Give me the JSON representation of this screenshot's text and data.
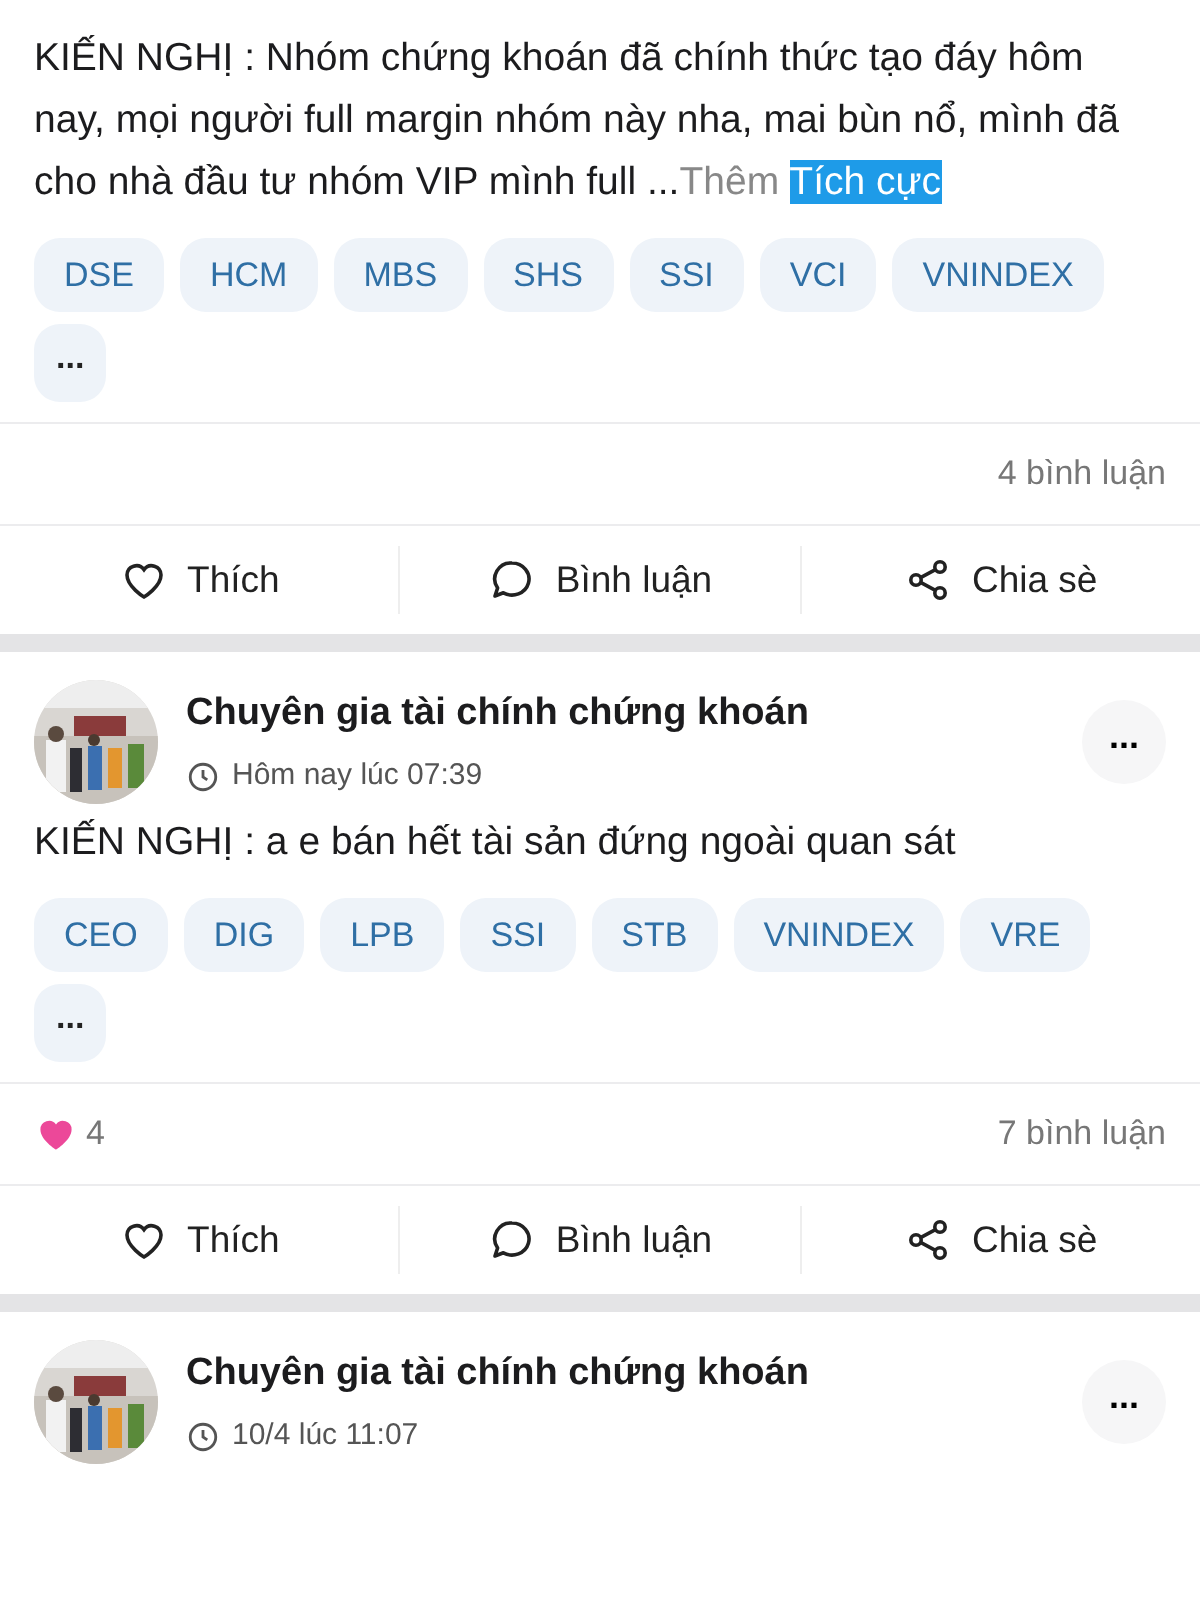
{
  "posts": [
    {
      "body": {
        "text": "KIẾN NGHỊ : Nhóm chứng khoán đã chính thức tạo đáy hôm nay, mọi người full margin nhóm này nha, mai bùn nổ, mình đã cho nhà đầu tư nhóm VIP mình full ...",
        "more": "Thêm",
        "sentiment": "Tích cực"
      },
      "tags": [
        "DSE",
        "HCM",
        "MBS",
        "SHS",
        "SSI",
        "VCI",
        "VNINDEX"
      ],
      "more_tags": "...",
      "stats": {
        "comments": "4 bình luận"
      },
      "actions": [
        {
          "kind": "like",
          "label": "Thích",
          "selected": false
        },
        {
          "kind": "comment",
          "label": "Bình luận"
        },
        {
          "kind": "share",
          "label": "Chia sè"
        }
      ]
    },
    {
      "author": "Chuyên gia tài chính chứng khoán",
      "time": "Hôm nay lúc 07:39",
      "menu": "...",
      "body": {
        "text": "KIẾN NGHỊ : a e bán hết tài sản đứng ngoài quan sát"
      },
      "tags": [
        "CEO",
        "DIG",
        "LPB",
        "SSI",
        "STB",
        "VNINDEX",
        "VRE"
      ],
      "more_tags": "...",
      "stats": {
        "likes": "4",
        "comments": "7 bình luận"
      },
      "actions": [
        {
          "kind": "like",
          "label": "Thích",
          "selected": false
        },
        {
          "kind": "comment",
          "label": "Bình luận"
        },
        {
          "kind": "share",
          "label": "Chia sè"
        }
      ]
    },
    {
      "author": "Chuyên gia tài chính chứng khoán",
      "time": "10/4 lúc 11:07",
      "menu": "..."
    }
  ]
}
